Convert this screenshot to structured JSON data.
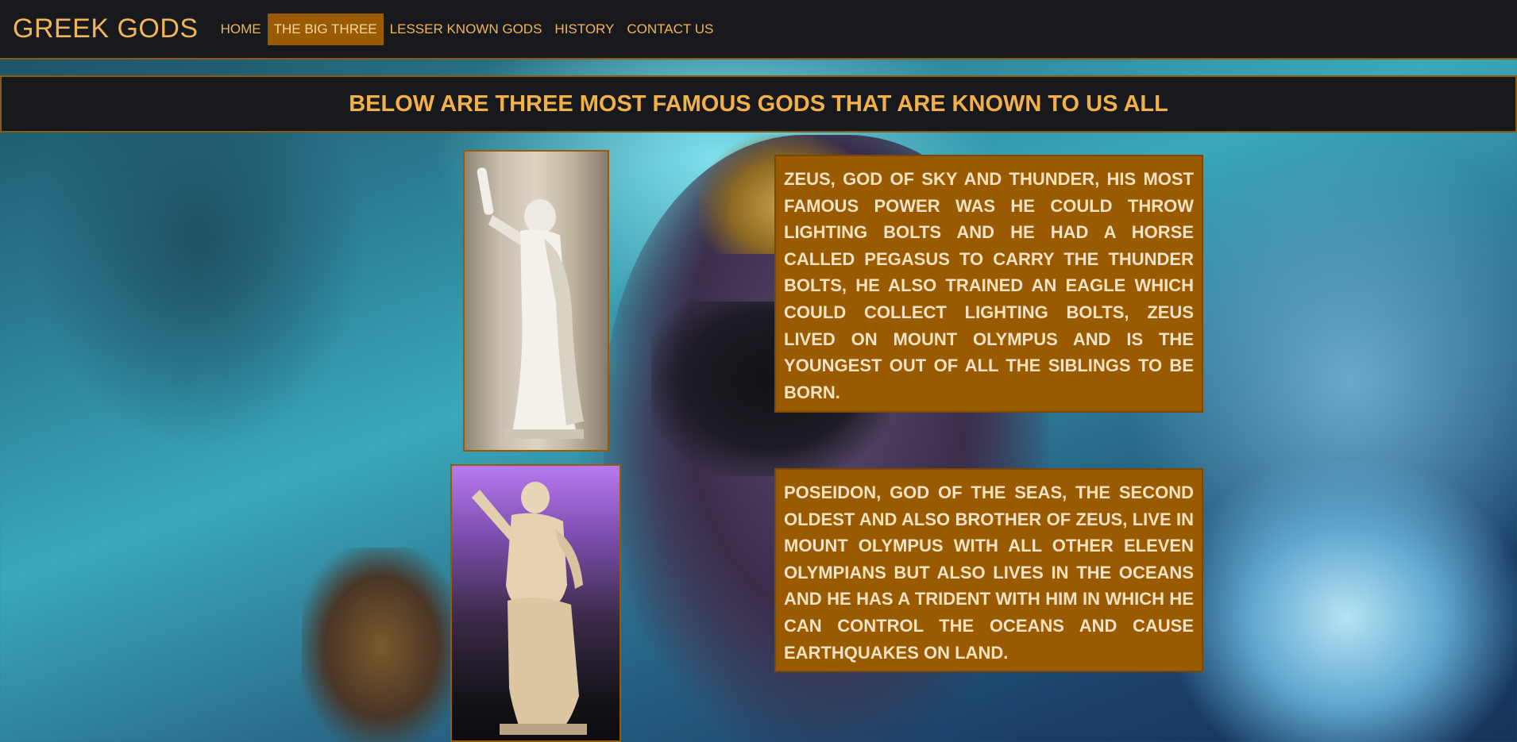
{
  "navbar": {
    "brand": "GREEK GODS",
    "items": [
      {
        "label": "HOME",
        "active": false
      },
      {
        "label": "THE BIG THREE",
        "active": true
      },
      {
        "label": "LESSER KNOWN GODS",
        "active": false
      },
      {
        "label": "HISTORY",
        "active": false
      },
      {
        "label": "CONTACT US",
        "active": false
      }
    ]
  },
  "banner": {
    "title": "BELOW ARE THREE MOST FAMOUS GODS THAT ARE KNOWN TO US ALL"
  },
  "gods": [
    {
      "image": "zeus-statue-image",
      "description": "ZEUS, GOD OF SKY AND THUNDER, HIS MOST FAMOUS POWER WAS HE COULD THROW LIGHTING BOLTS AND HE HAD A HORSE CALLED PEGASUS TO CARRY THE THUNDER BOLTS, HE ALSO TRAINED AN EAGLE WHICH COULD COLLECT LIGHTING BOLTS, ZEUS LIVED ON MOUNT OLYMPUS AND IS THE YOUNGEST OUT OF ALL THE SIBLINGS TO BE BORN."
    },
    {
      "image": "poseidon-statue-image",
      "description": "POSEIDON, GOD OF THE SEAS, THE SECOND OLDEST AND ALSO BROTHER OF ZEUS, LIVE IN MOUNT OLYMPUS WITH ALL OTHER ELEVEN OLYMPIANS BUT ALSO LIVES IN THE OCEANS AND HE HAS A TRIDENT WITH HIM IN WHICH HE CAN CONTROL THE OCEANS AND CAUSE EARTHQUAKES ON LAND."
    }
  ],
  "colors": {
    "navbar_bg": "#18191c",
    "accent": "#f0b55a",
    "active_nav_bg": "#9a5a00",
    "text_box_bg": "#9a5a00",
    "text_box_text": "#f3e2c4"
  }
}
